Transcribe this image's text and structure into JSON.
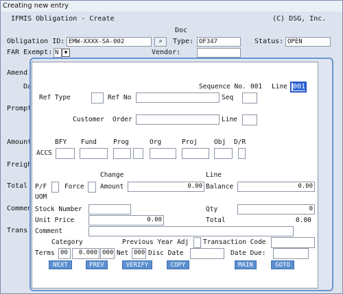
{
  "window": {
    "caption": "Creating new entry",
    "title": "IFMIS Obligation - Create",
    "copyright": "(C) DSG, Inc."
  },
  "form": {
    "obligation_id_label": "Obligation ID:",
    "obligation_id_value": "EMW-XXXX-SA-002",
    "doc_label": "Doc",
    "type_label": "Type:",
    "type_value": "OF347",
    "status_label": "Status:",
    "status_value": "OPEN",
    "far_exempt_label": "FAR Exempt:",
    "far_exempt_value": "N",
    "vendor_label": "Vendor:"
  },
  "background_labels": {
    "amend": "Amend",
    "da": "Da",
    "prompt": "Prompt",
    "amount": "Amount",
    "freight": "Freigh",
    "total": "Total",
    "comment": "Commen",
    "trans": "Trans"
  },
  "dialog": {
    "sequence_label": "Sequence No.",
    "sequence_value": "001",
    "line_label": "Line",
    "line_value": "001",
    "ref_type_label": "Ref Type",
    "ref_no_label": "Ref No",
    "seq_label": "Seq",
    "customer_label": "Customer",
    "order_label": "Order",
    "line2_label": "Line",
    "accs_label": "ACCS",
    "accs_headers": [
      "BFY",
      "Fund",
      "Prog",
      "Org",
      "Proj",
      "Obj",
      "D/R"
    ],
    "change_label": "Change",
    "line_header": "Line",
    "pf_label": "P/F",
    "force_label": "Force",
    "amount_label": "Amount",
    "amount_value": "0.00",
    "balance_label": "Balance",
    "balance_value": "0.00",
    "uom_label": "UOM",
    "stock_number_label": "Stock Number",
    "qty_label": "Qty",
    "qty_value": "0",
    "unit_price_label": "Unit Price",
    "unit_price_value": "0.00",
    "total_label": "Total",
    "total_value": "0.00",
    "comment_label": "Comment",
    "category_label": "Category",
    "prev_year_label": "Previous Year Adj",
    "transaction_code_label": "Transaction Code",
    "terms_label": "Terms",
    "terms_value1": "00",
    "terms_value2": "0.000",
    "terms_value3": "000",
    "net_label": "Net",
    "net_value": "000",
    "disc_date_label": "Disc Date",
    "date_due_label": "Date Due:",
    "buttons": {
      "next": "NEXT",
      "prev": "PREV",
      "verify": "VERIFY",
      "copy": "COPY",
      "main": "MAIN",
      "goto": "GOTO"
    }
  }
}
